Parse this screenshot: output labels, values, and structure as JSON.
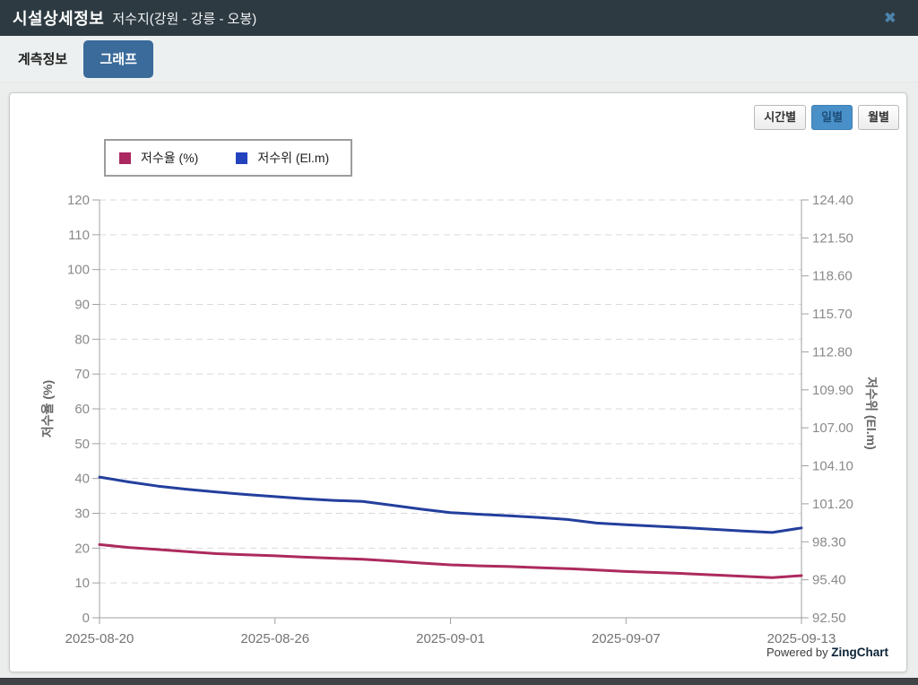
{
  "header": {
    "title": "시설상세정보",
    "subtitle": "저수지(강원 - 강릉 - 오봉)",
    "close_icon": "✖"
  },
  "tabs": [
    {
      "label": "계측정보",
      "active": false
    },
    {
      "label": "그래프",
      "active": true
    }
  ],
  "period_buttons": [
    {
      "label": "시간별",
      "active": false
    },
    {
      "label": "일별",
      "active": true
    },
    {
      "label": "월별",
      "active": false
    }
  ],
  "legend": [
    {
      "label": "저수율 (%)",
      "color": "#ab2860"
    },
    {
      "label": "저수위 (El.m)",
      "color": "#2342bd"
    }
  ],
  "footer": {
    "powered_by": "Powered by ",
    "brand": "ZingChart"
  },
  "colors": {
    "header_bg": "#2d3a42",
    "tab_active_bg": "#3a6b9b",
    "period_active_bg": "#4a90c8",
    "rate_line": "#ac2a5e",
    "level_line": "#233f9d",
    "grid": "#d9d9d9",
    "axis": "#a0a0a0",
    "tick_text": "#8a8a8a",
    "xlabel_text": "#737373",
    "axis_title": "#666666"
  },
  "chart_data": {
    "type": "line",
    "x": [
      "2025-08-20",
      "2025-08-21",
      "2025-08-22",
      "2025-08-23",
      "2025-08-24",
      "2025-08-25",
      "2025-08-26",
      "2025-08-27",
      "2025-08-28",
      "2025-08-29",
      "2025-08-30",
      "2025-08-31",
      "2025-09-01",
      "2025-09-02",
      "2025-09-03",
      "2025-09-04",
      "2025-09-05",
      "2025-09-06",
      "2025-09-07",
      "2025-09-08",
      "2025-09-09",
      "2025-09-10",
      "2025-09-11",
      "2025-09-12",
      "2025-09-13"
    ],
    "x_tick_labels": [
      "2025-08-20",
      "2025-08-26",
      "2025-09-01",
      "2025-09-07",
      "2025-09-13"
    ],
    "x_tick_indices": [
      0,
      6,
      12,
      18,
      24
    ],
    "series": [
      {
        "name": "저수율 (%)",
        "axis": "left",
        "color": "#ac2a5e",
        "values": [
          21.0,
          20.2,
          19.6,
          19.0,
          18.4,
          18.1,
          17.8,
          17.4,
          17.1,
          16.8,
          16.3,
          15.7,
          15.2,
          14.9,
          14.7,
          14.4,
          14.1,
          13.7,
          13.3,
          13.0,
          12.7,
          12.3,
          11.9,
          11.5,
          12.1
        ]
      },
      {
        "name": "저수위 (El.m)",
        "axis": "right",
        "color": "#233f9d",
        "values": [
          103.24,
          102.87,
          102.55,
          102.31,
          102.1,
          101.91,
          101.75,
          101.59,
          101.46,
          101.38,
          101.09,
          100.79,
          100.53,
          100.4,
          100.29,
          100.16,
          100.0,
          99.73,
          99.6,
          99.49,
          99.38,
          99.25,
          99.12,
          99.01,
          99.36
        ]
      }
    ],
    "left_axis": {
      "label": "저수율 (%)",
      "min": 0,
      "max": 120,
      "tick_step": 10,
      "ticks": [
        "0",
        "10",
        "20",
        "30",
        "40",
        "50",
        "60",
        "70",
        "80",
        "90",
        "100",
        "110",
        "120"
      ]
    },
    "right_axis": {
      "label": "저수위 (El.m)",
      "min": 92.5,
      "max": 124.4,
      "tick_step": 2.9,
      "ticks": [
        "92.50",
        "95.40",
        "98.30",
        "101.20",
        "104.10",
        "107.00",
        "109.90",
        "112.80",
        "115.70",
        "118.60",
        "121.50",
        "124.40"
      ]
    },
    "grid": "horizontal-dashed",
    "legend_position": "top-left"
  }
}
